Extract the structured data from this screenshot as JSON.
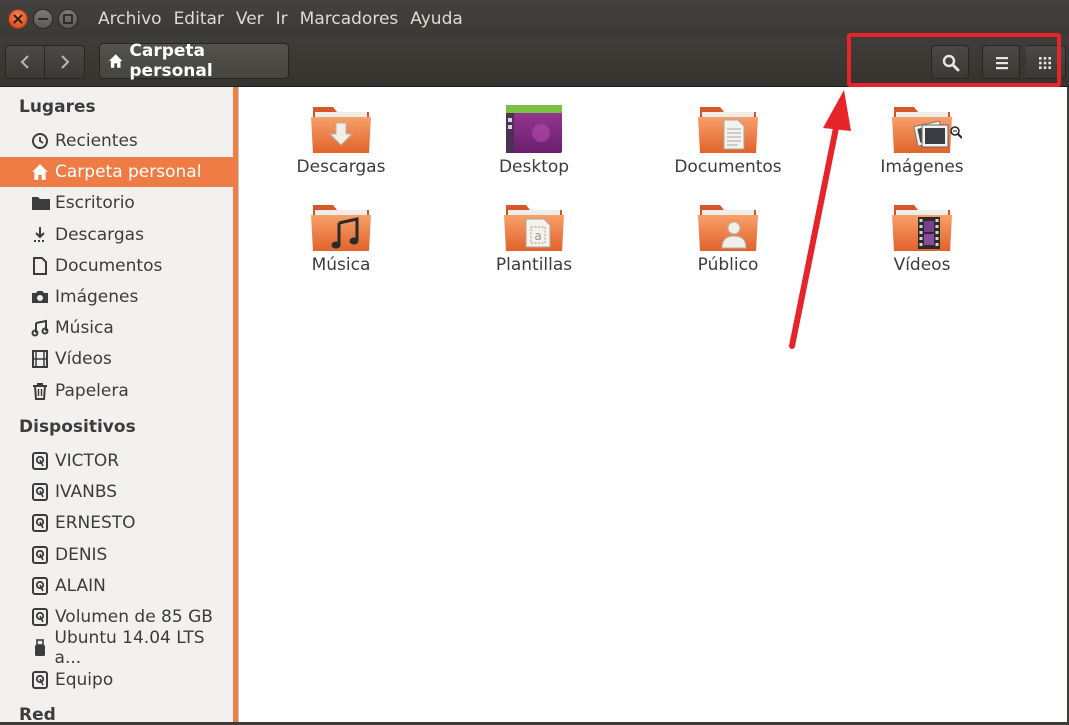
{
  "menu": [
    "Archivo",
    "Editar",
    "Ver",
    "Ir",
    "Marcadores",
    "Ayuda"
  ],
  "path": {
    "label": "Carpeta personal"
  },
  "sidebar": {
    "sections": [
      {
        "title": "Lugares"
      },
      {
        "title": "Dispositivos"
      },
      {
        "title": "Red"
      }
    ],
    "places": [
      {
        "label": "Recientes",
        "icon": "clock-icon"
      },
      {
        "label": "Carpeta personal",
        "icon": "home-icon",
        "active": true
      },
      {
        "label": "Escritorio",
        "icon": "folder-icon"
      },
      {
        "label": "Descargas",
        "icon": "download-icon"
      },
      {
        "label": "Documentos",
        "icon": "document-icon"
      },
      {
        "label": "Imágenes",
        "icon": "camera-icon"
      },
      {
        "label": "Música",
        "icon": "music-icon"
      },
      {
        "label": "Vídeos",
        "icon": "film-icon"
      },
      {
        "label": "Papelera",
        "icon": "trash-icon"
      }
    ],
    "devices": [
      {
        "label": "VICTOR",
        "icon": "drive-icon"
      },
      {
        "label": "IVANBS",
        "icon": "drive-icon"
      },
      {
        "label": "ERNESTO",
        "icon": "drive-icon"
      },
      {
        "label": "DENIS",
        "icon": "drive-icon"
      },
      {
        "label": "ALAIN",
        "icon": "drive-icon"
      },
      {
        "label": "Volumen de 85 GB",
        "icon": "drive-icon"
      },
      {
        "label": "Ubuntu 14.04 LTS a...",
        "icon": "usb-icon"
      },
      {
        "label": "Equipo",
        "icon": "drive-icon"
      }
    ]
  },
  "files": [
    {
      "label": "Descargas",
      "icon": "folder-download-icon"
    },
    {
      "label": "Desktop",
      "icon": "desktop-icon"
    },
    {
      "label": "Documentos",
      "icon": "folder-documents-icon"
    },
    {
      "label": "Imágenes",
      "icon": "folder-pictures-icon"
    },
    {
      "label": "Música",
      "icon": "folder-music-icon"
    },
    {
      "label": "Plantillas",
      "icon": "folder-templates-icon"
    },
    {
      "label": "Público",
      "icon": "folder-public-icon"
    },
    {
      "label": "Vídeos",
      "icon": "folder-videos-icon"
    }
  ],
  "colors": {
    "accent": "#ef7c45",
    "highlight": "#e8242b"
  }
}
